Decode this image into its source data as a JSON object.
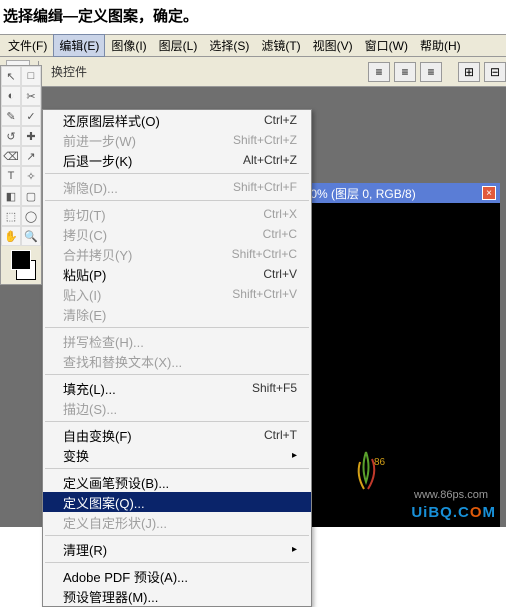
{
  "instruction": "选择编缉—定义图案，确定。",
  "menubar": {
    "items": [
      "文件(F)",
      "编辑(E)",
      "图像(I)",
      "图层(L)",
      "选择(S)",
      "滤镜(T)",
      "视图(V)",
      "窗口(W)",
      "帮助(H)"
    ],
    "open_index": 1
  },
  "optionsbar": {
    "label": "换控件",
    "icons": [
      "move",
      "auto-select"
    ]
  },
  "dropdown": {
    "groups": [
      [
        {
          "label": "还原图层样式(O)",
          "shortcut": "Ctrl+Z",
          "disabled": false
        },
        {
          "label": "前进一步(W)",
          "shortcut": "Shift+Ctrl+Z",
          "disabled": true
        },
        {
          "label": "后退一步(K)",
          "shortcut": "Alt+Ctrl+Z",
          "disabled": false
        }
      ],
      [
        {
          "label": "渐隐(D)...",
          "shortcut": "Shift+Ctrl+F",
          "disabled": true
        }
      ],
      [
        {
          "label": "剪切(T)",
          "shortcut": "Ctrl+X",
          "disabled": true
        },
        {
          "label": "拷贝(C)",
          "shortcut": "Ctrl+C",
          "disabled": true
        },
        {
          "label": "合并拷贝(Y)",
          "shortcut": "Shift+Ctrl+C",
          "disabled": true
        },
        {
          "label": "粘贴(P)",
          "shortcut": "Ctrl+V",
          "disabled": false
        },
        {
          "label": "贴入(I)",
          "shortcut": "Shift+Ctrl+V",
          "disabled": true
        },
        {
          "label": "清除(E)",
          "shortcut": "",
          "disabled": true
        }
      ],
      [
        {
          "label": "拼写检查(H)...",
          "shortcut": "",
          "disabled": true
        },
        {
          "label": "查找和替换文本(X)...",
          "shortcut": "",
          "disabled": true
        }
      ],
      [
        {
          "label": "填充(L)...",
          "shortcut": "Shift+F5",
          "disabled": false
        },
        {
          "label": "描边(S)...",
          "shortcut": "",
          "disabled": true
        }
      ],
      [
        {
          "label": "自由变换(F)",
          "shortcut": "Ctrl+T",
          "disabled": false
        },
        {
          "label": "变换",
          "shortcut": "",
          "disabled": false,
          "submenu": true
        }
      ],
      [
        {
          "label": "定义画笔预设(B)...",
          "shortcut": "",
          "disabled": false
        },
        {
          "label": "定义图案(Q)...",
          "shortcut": "",
          "disabled": false,
          "highlight": true
        },
        {
          "label": "定义自定形状(J)...",
          "shortcut": "",
          "disabled": true
        }
      ],
      [
        {
          "label": "清理(R)",
          "shortcut": "",
          "disabled": false,
          "submenu": true
        }
      ],
      [
        {
          "label": "Adobe PDF 预设(A)...",
          "shortcut": "",
          "disabled": false
        },
        {
          "label": "预设管理器(M)...",
          "shortcut": "",
          "disabled": false
        }
      ]
    ]
  },
  "document": {
    "title": "100%  (图层 0, RGB/8)"
  },
  "watermark": {
    "url": "www.86ps.com",
    "brand_pre": "UiBQ.C",
    "brand_o": "O",
    "brand_post": "M"
  },
  "tools": [
    "↖",
    "□",
    "◐",
    "✂",
    "✎",
    "✓",
    "↺",
    "✚",
    "⌫",
    "↗",
    "T",
    "✧",
    "◧",
    "▢",
    "⬚",
    "◯",
    "✋",
    "🔍",
    "—",
    "—"
  ]
}
